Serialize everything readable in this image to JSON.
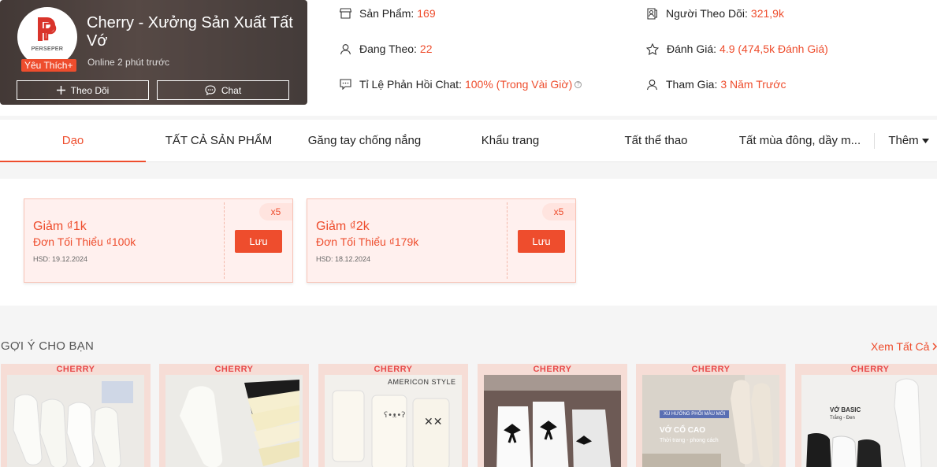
{
  "shop": {
    "logo_text": "PERSEPER",
    "name": "Cherry - Xưởng Sản Xuất Tất Vớ",
    "favorite_badge": "Yêu Thích+",
    "online_status": "Online 2 phút trước",
    "follow_label": "Theo Dõi",
    "chat_label": "Chat"
  },
  "stats": {
    "products": {
      "label": "Sản Phẩm:",
      "value": "169"
    },
    "following": {
      "label": "Đang Theo:",
      "value": "22"
    },
    "chat_rate": {
      "label": "Tỉ Lệ Phản Hồi Chat:",
      "value": "100% (Trong Vài Giờ)"
    },
    "followers": {
      "label": "Người Theo Dõi:",
      "value": "321,9k"
    },
    "rating": {
      "label": "Đánh Giá:",
      "value": "4.9 (474,5k Đánh Giá)"
    },
    "joined": {
      "label": "Tham Gia:",
      "value": "3 Năm Trước"
    }
  },
  "tabs": [
    "Dạo",
    "TẤT CẢ SẢN PHẨM",
    "Găng tay chống nắng",
    "Khẩu trang",
    "Tất thể thao",
    "Tất mùa đông, dầy m..."
  ],
  "tabs_more": "Thêm",
  "vouchers": [
    {
      "title": "Giảm ₫1k",
      "min": "Đơn Tối Thiểu ₫100k",
      "expiry": "HSD: 19.12.2024",
      "qty": "x5",
      "save": "Lưu"
    },
    {
      "title": "Giảm ₫2k",
      "min": "Đơn Tối Thiểu ₫179k",
      "expiry": "HSD: 18.12.2024",
      "qty": "x5",
      "save": "Lưu"
    }
  ],
  "suggestions": {
    "title": "GỢI Ý CHO BẠN",
    "see_all": "Xem Tất Cả",
    "brand": "CHERRY",
    "product3_caption": "AMERICON STYLE",
    "product5_tag": "XU HƯỚNG PHỐI MÀU MỚI",
    "product5_caption": "VỚ CỔ CAO",
    "product5_sub": "Thời trang - phong cách",
    "product6_caption": "VỚ BASIC",
    "product6_sub": "Trắng - Đen"
  },
  "colors": {
    "accent": "#ee4d2d"
  }
}
